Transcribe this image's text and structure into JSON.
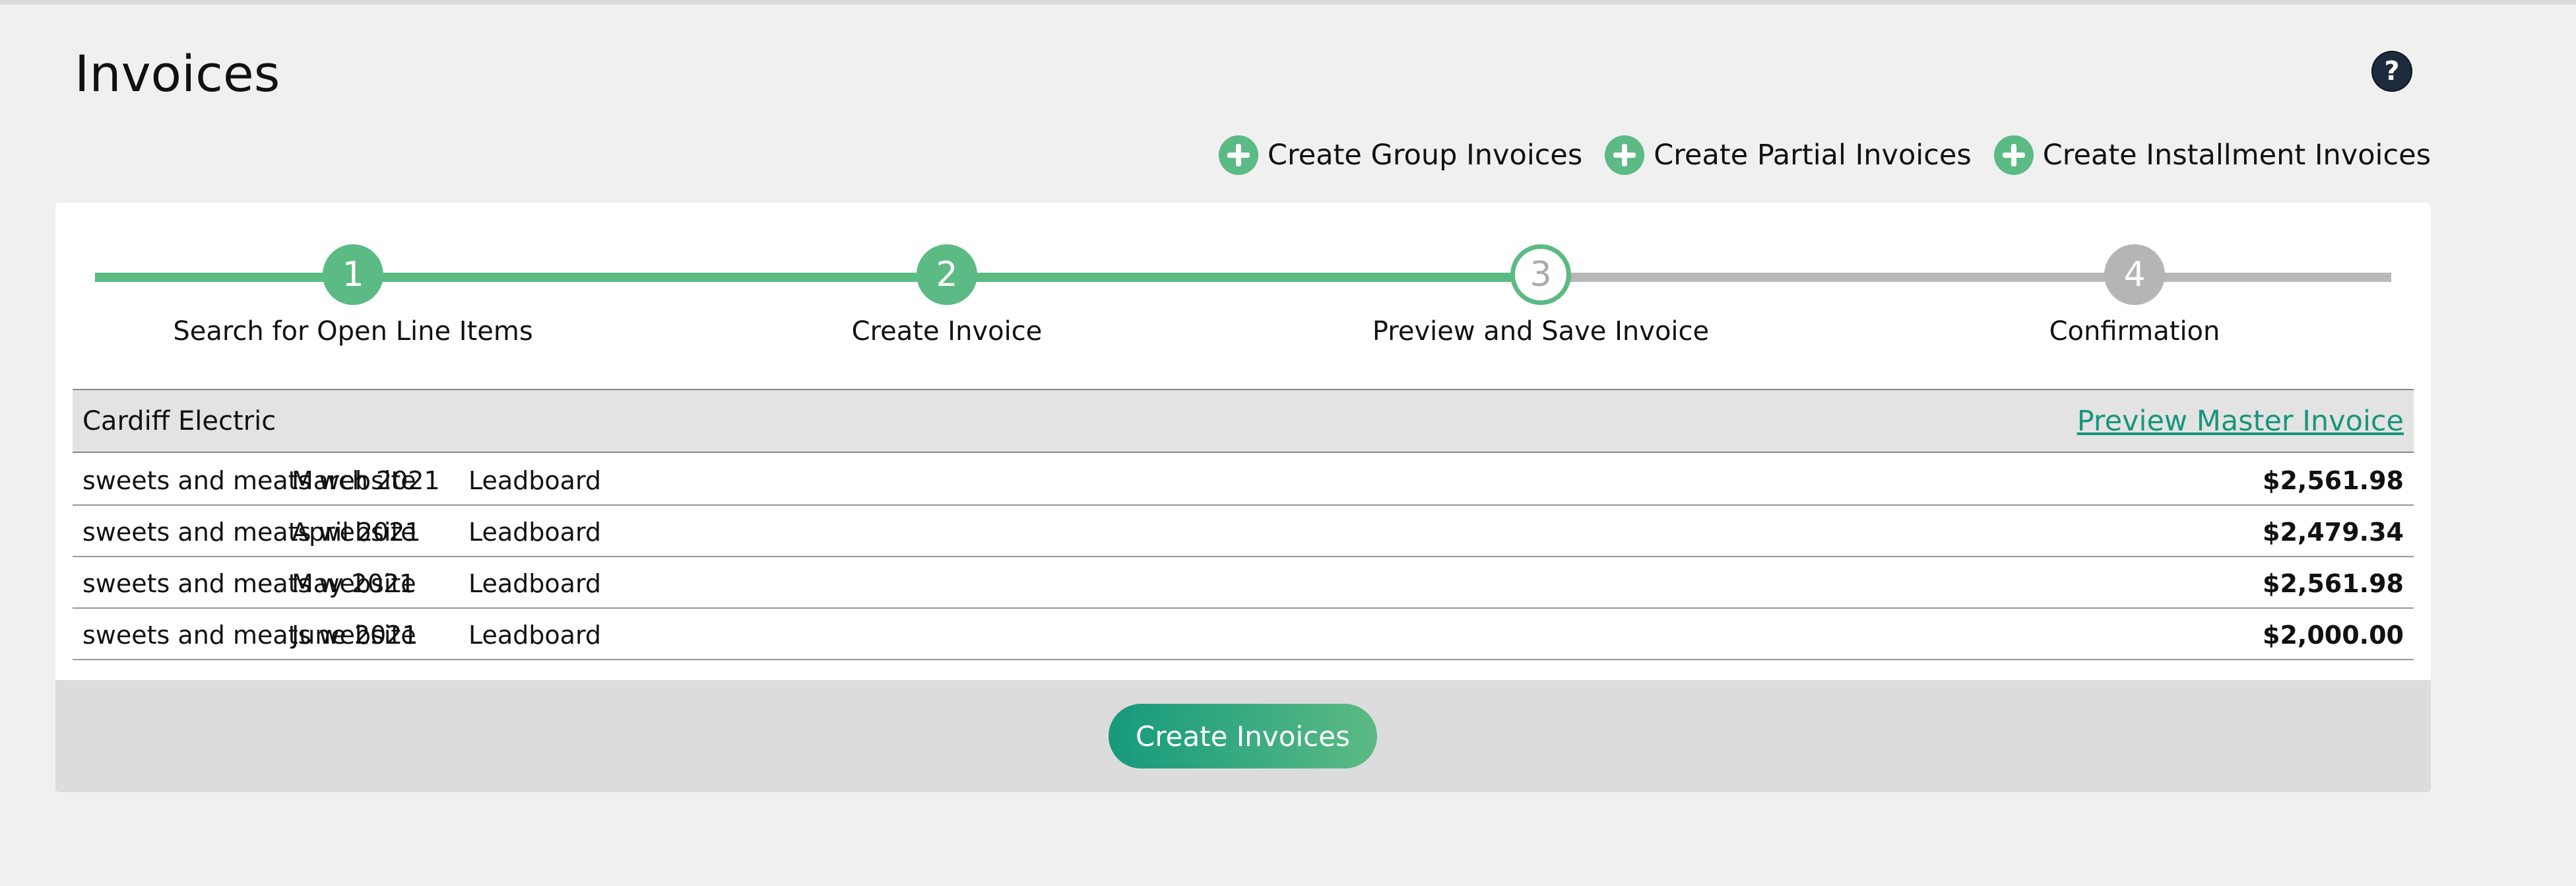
{
  "page": {
    "title": "Invoices",
    "help_label": "?"
  },
  "actions": [
    {
      "label": "Create Group Invoices",
      "icon": "plus-circle-icon"
    },
    {
      "label": "Create Partial Invoices",
      "icon": "plus-circle-icon"
    },
    {
      "label": "Create Installment Invoices",
      "icon": "plus-circle-icon"
    }
  ],
  "stepper": {
    "steps": [
      {
        "number": "1",
        "label": "Search for Open Line Items",
        "state": "done"
      },
      {
        "number": "2",
        "label": "Create Invoice",
        "state": "done"
      },
      {
        "number": "3",
        "label": "Preview and Save Invoice",
        "state": "current"
      },
      {
        "number": "4",
        "label": "Confirmation",
        "state": "todo"
      }
    ],
    "colors": {
      "done": "#5cba84",
      "todo": "#b8b8b8"
    }
  },
  "invoice_group": {
    "client": "Cardiff Electric",
    "preview_link": "Preview Master Invoice",
    "rows": [
      {
        "project": "sweets and meats website",
        "month": "March 2021",
        "type": "Leadboard",
        "amount": "$2,561.98"
      },
      {
        "project": "sweets and meats website",
        "month": "April 2021",
        "type": "Leadboard",
        "amount": "$2,479.34"
      },
      {
        "project": "sweets and meats website",
        "month": "May 2021",
        "type": "Leadboard",
        "amount": "$2,561.98"
      },
      {
        "project": "sweets and meats website",
        "month": "June 2021",
        "type": "Leadboard",
        "amount": "$2,000.00"
      }
    ]
  },
  "footer": {
    "create_button": "Create Invoices"
  },
  "colors": {
    "accent": "#5cba84",
    "link": "#17967b",
    "help_bg": "#1d2b3c"
  }
}
